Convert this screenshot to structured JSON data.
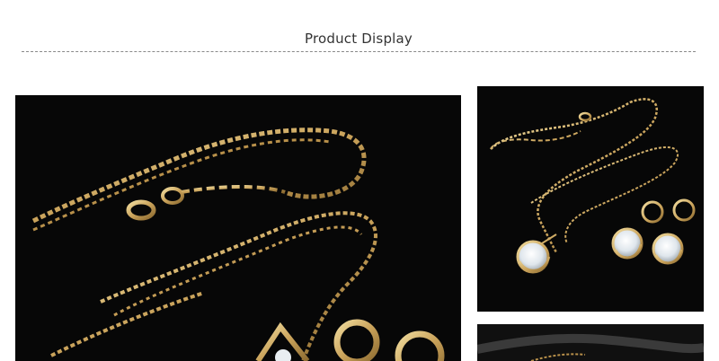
{
  "header": {
    "title": "Product Display",
    "divider_color": "#8a8a8a"
  },
  "photos": {
    "main": {
      "subject": "gold-chain-necklace-and-earrings-closeup"
    },
    "side_top": {
      "subject": "gold-necklace-pendant-and-earrings-set"
    },
    "side_bottom": {
      "subject": "jewelry-photo-partial"
    }
  },
  "colors": {
    "background": "#ffffff",
    "photo_background": "#070707",
    "gold": "#d8b468",
    "gold_highlight": "#f1dc9e",
    "gem": "#e9eef2"
  }
}
